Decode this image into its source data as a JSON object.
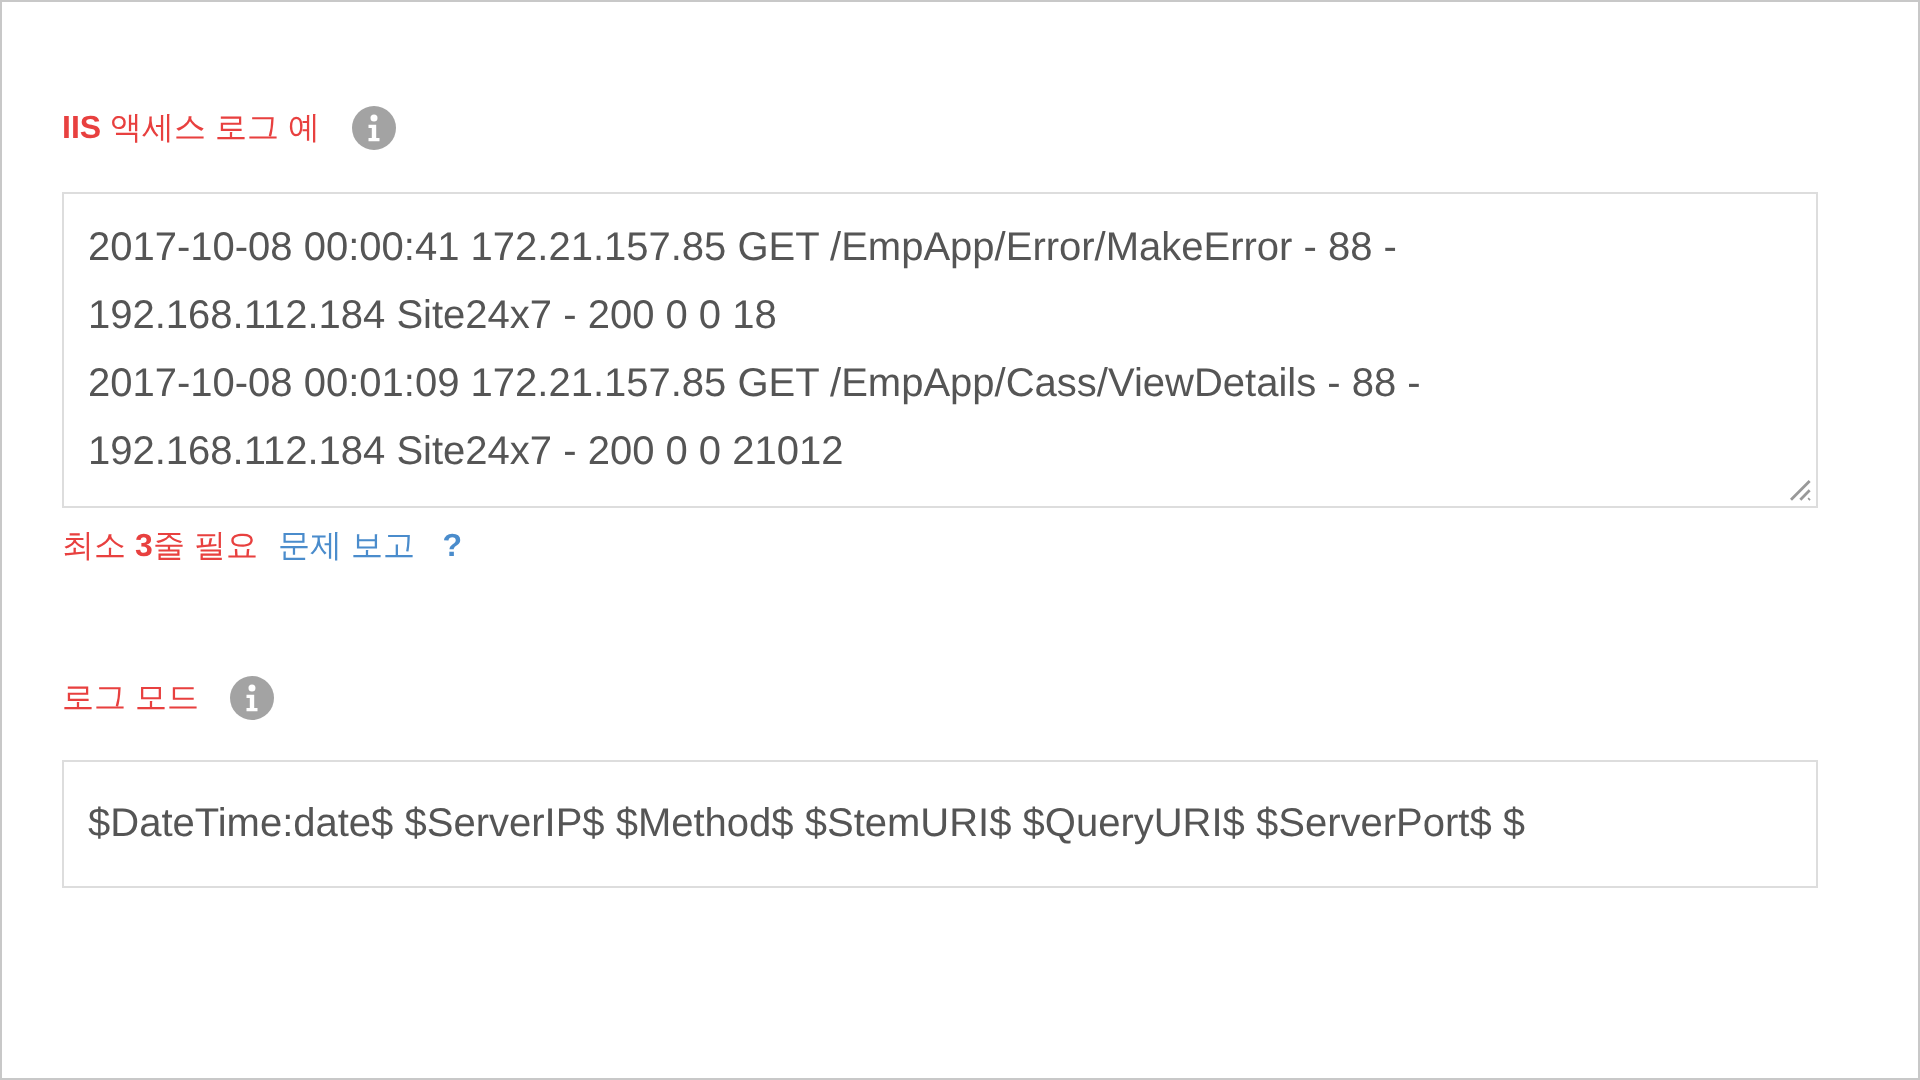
{
  "log_example": {
    "label": "**IIS** 액세스 로그 예",
    "lines": [
      "2017-10-08 00:00:41 172.21.157.85 GET /EmpApp/Error/MakeError - 88 -",
      "192.168.112.184 Site24x7 - 200 0 0 18",
      "2017-10-08 00:01:09 172.21.157.85 GET /EmpApp/Cass/ViewDetails - 88 -",
      "192.168.112.184 Site24x7 - 200 0 0 21012"
    ],
    "hint": "최소 **3**줄 필요",
    "report_link": "문제 보고",
    "help_link": "?"
  },
  "log_mode": {
    "label": "로그 모드",
    "value": "$DateTime:date$ $ServerIP$ $Method$ $StemURI$ $QueryURI$ $ServerPort$ $"
  }
}
